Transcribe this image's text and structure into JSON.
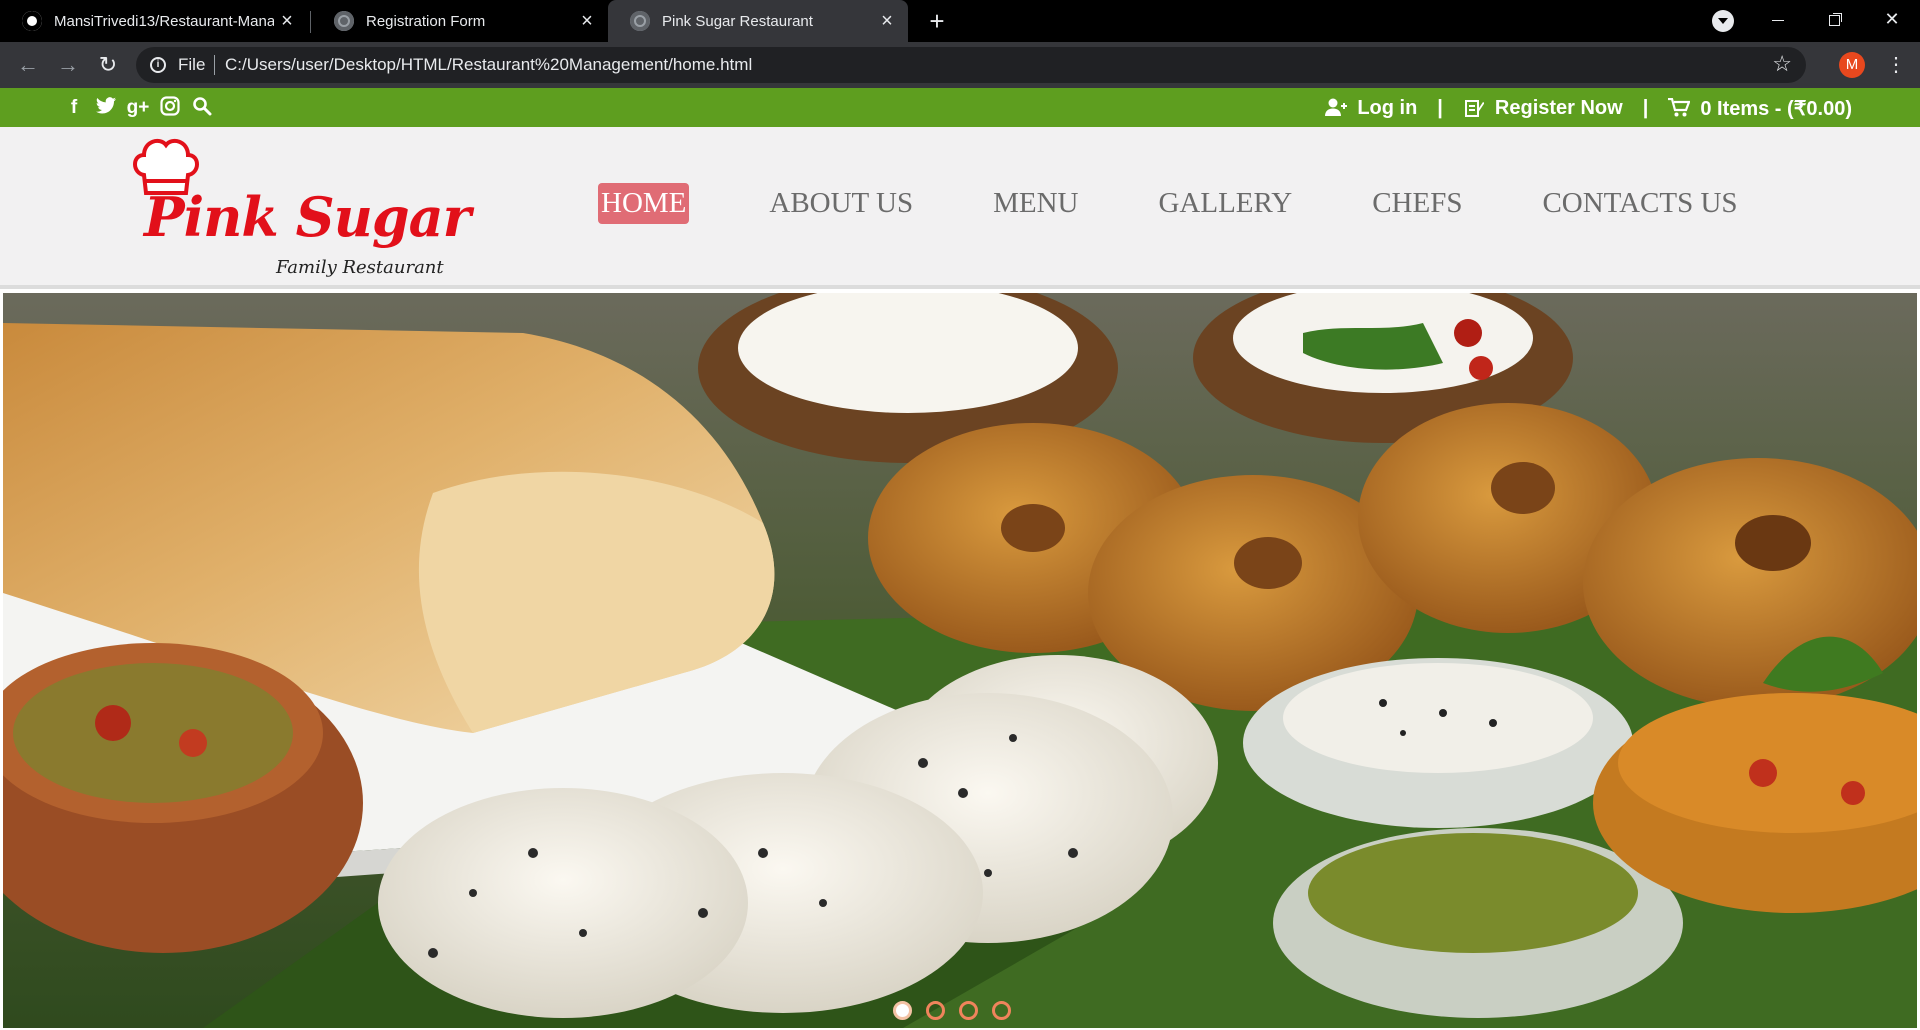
{
  "browser": {
    "tabs": [
      {
        "title": "MansiTrivedi13/Restaurant-Mana",
        "icon": "github-icon"
      },
      {
        "title": "Registration Form",
        "icon": "globe-icon"
      },
      {
        "title": "Pink Sugar Restaurant",
        "icon": "globe-icon",
        "active": true
      }
    ],
    "scheme": "File",
    "url": "C:/Users/user/Desktop/HTML/Restaurant%20Management/home.html",
    "profile_initial": "M",
    "profile_color": "#e8481e"
  },
  "topbar": {
    "background": "#5e9e1f",
    "social_icons": [
      "facebook-icon",
      "twitter-icon",
      "google-plus-icon",
      "instagram-icon",
      "search-icon"
    ],
    "social_glyphs": [
      "f",
      "t",
      "g+",
      "◎",
      "⚲"
    ],
    "login": "Log in",
    "register": "Register Now",
    "cart": "0 Items - (₹0.00)",
    "separator": "|"
  },
  "logo": {
    "name": "Pink Sugar",
    "tagline": "Family Restaurant",
    "color": "#e2101a"
  },
  "nav": {
    "items": [
      "HOME",
      "ABOUT US",
      "MENU",
      "GALLERY",
      "CHEFS",
      "CONTACTS US"
    ],
    "active_index": 0,
    "active_color": "#e06c75"
  },
  "slider": {
    "slide_count": 4,
    "active_slide": 0,
    "dot_color": "#f0845c"
  }
}
